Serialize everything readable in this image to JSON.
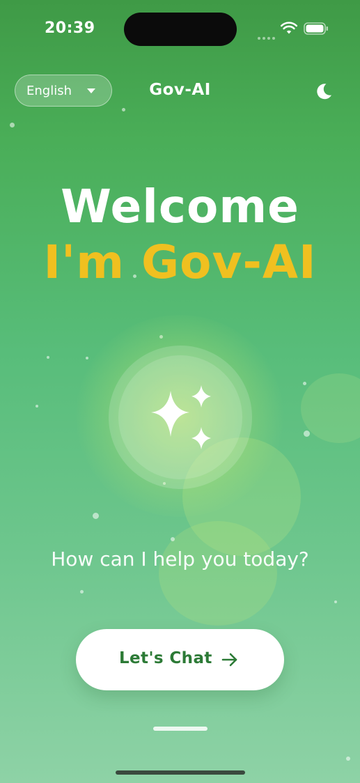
{
  "status_bar": {
    "time": "20:39"
  },
  "header": {
    "language_selected": "English",
    "title": "Gov-AI",
    "theme_icon": "moon-icon"
  },
  "hero": {
    "welcome": "Welcome",
    "subtitle": "I'm Gov-AI",
    "icon": "sparkles-icon"
  },
  "prompt": "How can I help you today?",
  "cta": {
    "label": "Let's Chat",
    "icon": "arrow-right-icon"
  },
  "colors": {
    "accent_yellow": "#f0c020",
    "brand_green": "#2c7a36",
    "background_top": "#3f9a46",
    "background_bottom": "#8ed2a6"
  }
}
